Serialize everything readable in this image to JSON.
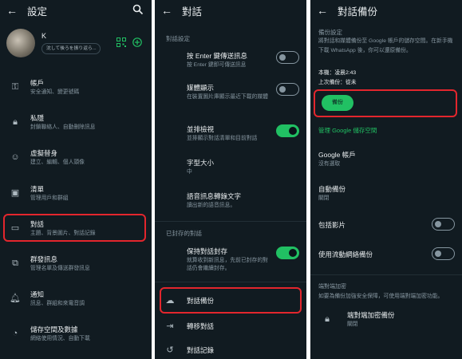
{
  "p1": {
    "title": "設定",
    "profile": {
      "name": "K",
      "status": "沈して後ろを振り返ら..."
    },
    "items": [
      {
        "t": "帳戶",
        "s": "安全通知、變更號碼"
      },
      {
        "t": "私隱",
        "s": "封鎖聯絡人、自動刪除訊息"
      },
      {
        "t": "虛擬替身",
        "s": "建立、編輯、個人頭像"
      },
      {
        "t": "清單",
        "s": "管理用戶和群組"
      },
      {
        "t": "對話",
        "s": "主題、背景圖片、對話記錄"
      },
      {
        "t": "群發訊息",
        "s": "管理名單及傳送群發訊息"
      },
      {
        "t": "通知",
        "s": "訊息、群組和來電音調"
      },
      {
        "t": "儲存空間及數據",
        "s": "網絡使用情況、自動下載"
      }
    ]
  },
  "p2": {
    "title": "對話",
    "section1": "對話設定",
    "items": [
      {
        "t": "按 Enter 鍵傳送訊息",
        "s": "按 Enter 鍵即可傳送訊息"
      },
      {
        "t": "媒體顯示",
        "s": "在裝置圖片庫顯示最近下載的媒體"
      },
      {
        "t": "並排檢視",
        "s": "並排顯示對話清單和目前對話"
      },
      {
        "t": "字型大小",
        "s": "中"
      },
      {
        "t": "語音訊息轉錄文字",
        "s": "讀出新的語音訊息。"
      }
    ],
    "section2": "已封存的對話",
    "archive": {
      "t": "保持對話封存",
      "s": "就算收到新訊息，先前已封存的對話仍會繼續封存。"
    },
    "backup": "對話備份",
    "transfer": "轉移對話",
    "history": "對話記錄"
  },
  "p3": {
    "title": "對話備份",
    "section": "備份設定",
    "desc": "將對話和媒體備份至 Google 帳戶的儲存空間。在新手機下載 WhatsApp 後，你可以還原備份。",
    "local": "本機：凌晨2:43",
    "last": "上次備份：從未",
    "backup_btn": "備份",
    "manage": "管理 Google 儲存空間",
    "google": {
      "t": "Google 帳戶",
      "s": "沒有選取"
    },
    "auto": {
      "t": "自動備份",
      "s": "關閉"
    },
    "videos": "包括影片",
    "cellular": "使用流動網絡備份",
    "e2e_section": "端對端加密",
    "e2e_desc": "如要為備份加強安全保障，可使用端對端加密功能。",
    "e2e": {
      "t": "端對端加密備份",
      "s": "關閉"
    }
  }
}
